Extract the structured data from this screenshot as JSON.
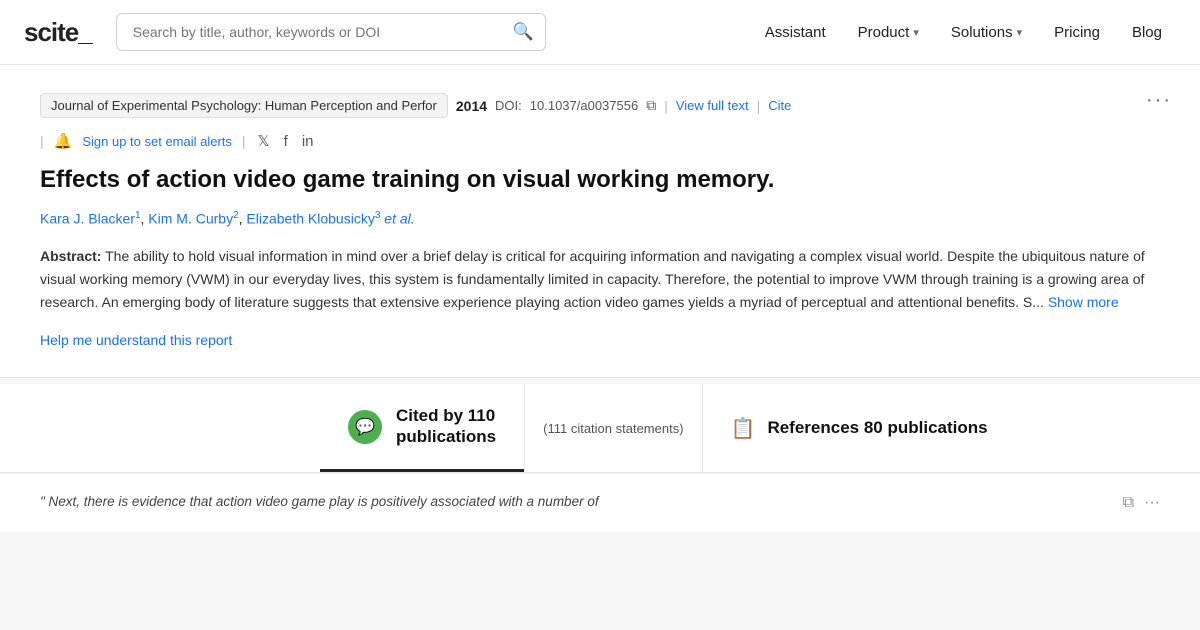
{
  "navbar": {
    "logo": "scite_",
    "search_placeholder": "Search by title, author, keywords or DOI",
    "nav_items": [
      {
        "id": "assistant",
        "label": "Assistant",
        "has_chevron": false
      },
      {
        "id": "product",
        "label": "Product",
        "has_chevron": true
      },
      {
        "id": "solutions",
        "label": "Solutions",
        "has_chevron": true
      },
      {
        "id": "pricing",
        "label": "Pricing",
        "has_chevron": false
      },
      {
        "id": "blog",
        "label": "Blog",
        "has_chevron": false
      }
    ]
  },
  "paper": {
    "journal": "Journal of Experimental Psychology: Human Perception and Perfor",
    "year": "2014",
    "doi_label": "DOI:",
    "doi_value": "10.1037/a0037556",
    "view_full_text": "View full text",
    "cite_label": "Cite",
    "alert_label": "Sign up to set email alerts",
    "title": "Effects of action video game training on visual working memory.",
    "authors": [
      {
        "name": "Kara J. Blacker",
        "sup": "1"
      },
      {
        "name": "Kim M. Curby",
        "sup": "2"
      },
      {
        "name": "Elizabeth Klobusicky",
        "sup": "3"
      }
    ],
    "et_al": "et al.",
    "abstract_label": "Abstract:",
    "abstract_text": "The ability to hold visual information in mind over a brief delay is critical for acquiring information and navigating a complex visual world. Despite the ubiquitous nature of visual working memory (VWM) in our everyday lives, this system is fundamentally limited in capacity. Therefore, the potential to improve VWM through training is a growing area of research. An emerging body of literature suggests that extensive experience playing action video games yields a myriad of perceptual and attentional benefits. S...",
    "show_more": "Show more",
    "help_link": "Help me understand this report",
    "more_options": "···"
  },
  "citations": {
    "cited_by_label": "Cited by 110",
    "cited_by_sub": "publications",
    "citation_statements": "(111 citation statements)",
    "references_label": "References 80 publications",
    "active_tab": "cited_by",
    "quote_text": "\" Next, there is evidence that action video game play is positively associated with a number of",
    "icons": {
      "citation": "💬",
      "references": "📋",
      "copy": "⧉",
      "more": "···"
    }
  }
}
